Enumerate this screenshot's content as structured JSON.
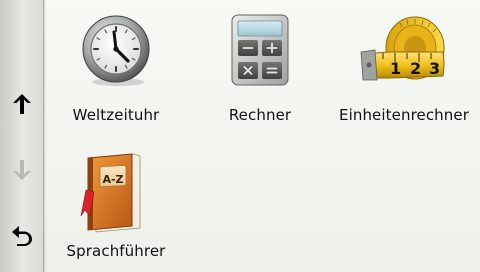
{
  "sidebar": {
    "up_icon": "arrow-up-icon",
    "down_icon": "arrow-down-icon",
    "back_icon": "back-arrow-icon"
  },
  "apps": [
    {
      "label": "Weltzeituhr",
      "icon": "clock-icon"
    },
    {
      "label": "Rechner",
      "icon": "calculator-icon"
    },
    {
      "label": "Einheitenrechner",
      "icon": "tape-measure-icon",
      "tape_digits": [
        "1",
        "2",
        "3"
      ]
    },
    {
      "label": "Sprachführer",
      "icon": "phrasebook-icon",
      "book_text": "A-Z"
    }
  ],
  "colors": {
    "icon_active": "#000000",
    "icon_disabled": "#b7bab4",
    "tape_yellow": "#f2c21b",
    "book_orange": "#d8741e"
  }
}
